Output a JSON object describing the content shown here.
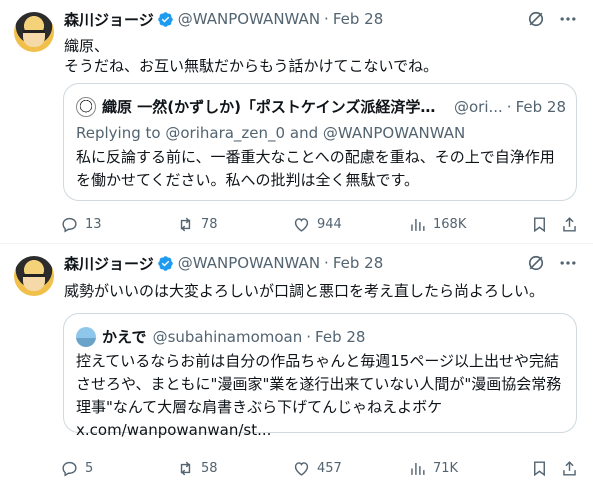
{
  "colors": {
    "verified": "#1d9bf0",
    "muted": "#536471",
    "text": "#0f1419",
    "border": "#cfd9de"
  },
  "tweets": [
    {
      "author_name": "森川ジョージ",
      "handle": "@WANPOWANWAN",
      "separator": "·",
      "date": "Feb 28",
      "text": "織原、\nそうだね、お互い無駄だからもう話かけてこないでね。",
      "quote": {
        "author_name": "織原 一然(かずしか)「ポストケインズ派経済学の...",
        "handle": "@ori...",
        "separator": "·",
        "date": "Feb 28",
        "replying_prefix": "Replying to",
        "replying_handle1": "@orihara_zen_0",
        "replying_and": "and",
        "replying_handle2": "@WANPOWANWAN",
        "text": "私に反論する前に、一番重大なことへの配慮を重ね、その上で自浄作用\nを働かせてください。私への批判は全く無駄です。"
      },
      "stats": {
        "replies": "13",
        "reposts": "78",
        "likes": "944",
        "views": "168K"
      }
    },
    {
      "author_name": "森川ジョージ",
      "handle": "@WANPOWANWAN",
      "separator": "·",
      "date": "Feb 28",
      "text": "威勢がいいのは大変よろしいが口調と悪口を考え直したら尚よろしい。",
      "quote": {
        "author_name": "かえで",
        "handle": "@subahinamomoan",
        "separator": "·",
        "date": "Feb 28",
        "text": "控えているならお前は自分の作品ちゃんと毎週15ページ以上出せや完結\nさせろや、まともに\"漫画家\"業を遂行出来ていない人間が\"漫画協会常務\n理事\"なんて大層な肩書きぶら下げてんじゃねえよボケ\nx.com/wanpowanwan/st..."
      },
      "stats": {
        "replies": "5",
        "reposts": "58",
        "likes": "457",
        "views": "71K"
      }
    }
  ]
}
